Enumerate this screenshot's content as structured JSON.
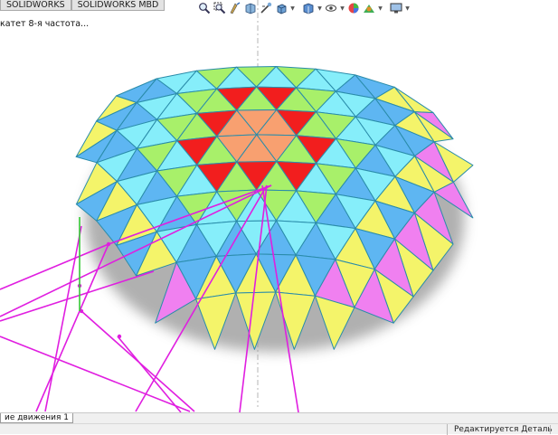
{
  "tabs": [
    "SOLIDWORKS",
    "SOLIDWORKS MBD"
  ],
  "breadcrumb": "катет 8-я частота...",
  "hud_icons": [
    "zoom-to-fit-icon",
    "zoom-to-area-icon",
    "previous-view-icon",
    "section-view-icon",
    "dynamic-annotation-icon",
    "view-orientation-icon",
    "display-style-icon",
    "hide-show-items-icon",
    "edit-appearance-icon",
    "apply-scene-icon",
    "view-settings-icon"
  ],
  "bottom_tab": "ие движения 1",
  "status": "Редактируется Деталь",
  "colors": {
    "magenta": "#f080f0",
    "yellow": "#f4f46a",
    "cyan": "#86eefa",
    "blue": "#5eb6f2",
    "green": "#a8f06a",
    "red": "#f21e1e",
    "orange": "#f8a070",
    "edge": "#2a8caa",
    "sketch": "#e01ee0"
  }
}
